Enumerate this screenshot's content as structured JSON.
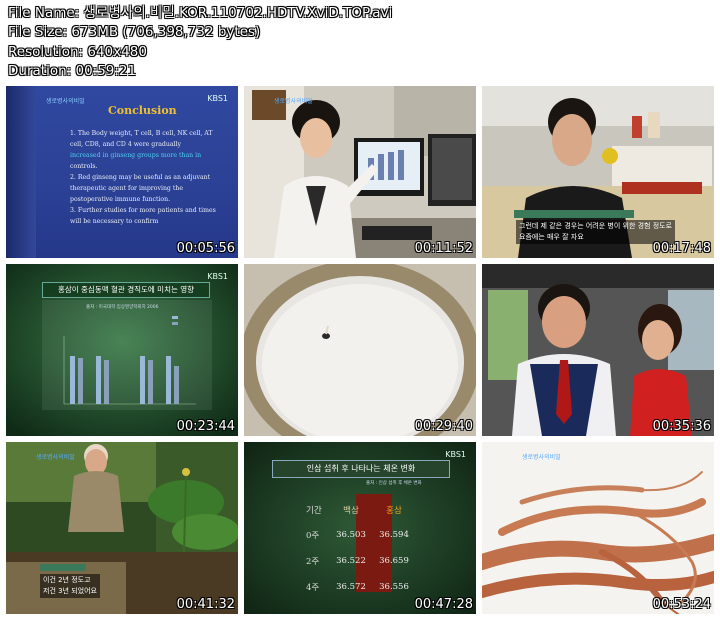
{
  "file_info": {
    "name": "File Name: 생로병사의.비밀.KOR.110702.HDTV.XviD.TOP.avi",
    "size": "File Size: 673MB (706,398,732 bytes)",
    "resolution": "Resolution: 640x480",
    "duration": "Duration: 00:59:21"
  },
  "thumbnails": [
    {
      "timestamp": "00:05:56"
    },
    {
      "timestamp": "00:11:52"
    },
    {
      "timestamp": "00:17:48"
    },
    {
      "timestamp": "00:23:44"
    },
    {
      "timestamp": "00:29:40"
    },
    {
      "timestamp": "00:35:36"
    },
    {
      "timestamp": "00:41:32"
    },
    {
      "timestamp": "00:47:28"
    },
    {
      "timestamp": "00:53:24"
    }
  ],
  "broadcaster": "KBS1",
  "slide1": {
    "title": "Conclusion",
    "lines": [
      "1. The Body weight, T cell, B cell, NK cell, AT",
      "cell, CD8, and CD 4 were gradually",
      "increased in ginseng groups more than in",
      "controls.",
      "2. Red ginseng may be useful as an adjuvant",
      "therapeutic agent for improving the",
      "postoperative immune function.",
      "3. Further studies for more patients and times",
      "will be necessary to confirm"
    ]
  },
  "thumb3_subs": [
    "그런데 제 같은 경우는 어려운 병이 위한 경험 정도로",
    "요즘에는 매우 잘 자요"
  ],
  "thumb4_chart": {
    "title": "홍삼이 중심동맥 혈관 경직도에 미치는 영향",
    "source": "출처 : 미국대학 임상영양학회지 2006"
  },
  "thumb7_subs": [
    "이건 2년 정도고",
    "저건 3년 되었어요"
  ],
  "table": {
    "title": "인삼 섭취 후 나타나는 체온 변화",
    "source": "출처 : 인삼 섭취 후 체온 변화",
    "headers": [
      "기간",
      "백삼",
      "홍삼"
    ],
    "rows": [
      [
        "0주",
        "36.503",
        "36.594"
      ],
      [
        "2주",
        "36.522",
        "36.659"
      ],
      [
        "4주",
        "36.572",
        "36.556"
      ]
    ]
  },
  "colors": {
    "slide_bg": "#2a3e8c",
    "chart_bg": "#1e4a2a",
    "table_bg": "#1b3a24",
    "hongsam_col": "#7a1a10"
  }
}
